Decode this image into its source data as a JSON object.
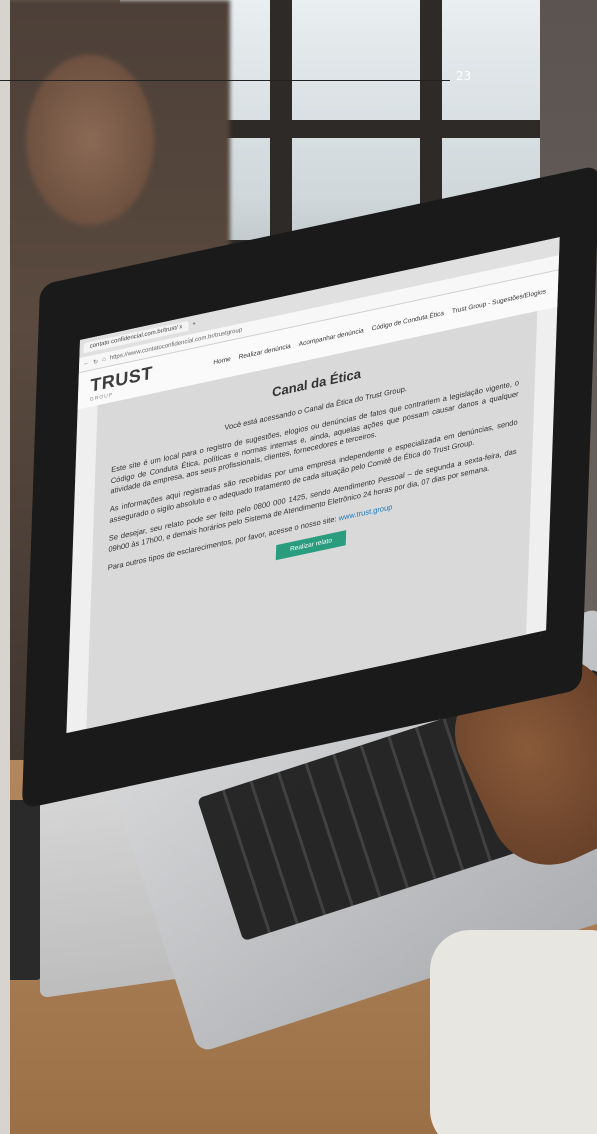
{
  "page_number": "23",
  "browser": {
    "tab_title": "contato confidencial.com.br/trust/ x",
    "url": "https://www.contatoconfidencial.com.br/trustgroup"
  },
  "site": {
    "logo_text": "TRUST",
    "logo_sub": "GROUP",
    "nav": [
      "Home",
      "Realizar denúncia",
      "Acompanhar denúncia",
      "Código de Conduta Ética",
      "Trust Group - Sugestões/Elogios"
    ],
    "title": "Canal da Ética",
    "intro": "Você está acessando o Canal da Ética do Trust Group.",
    "paragraph1": "Este site é um local para o registro de sugestões, elogios ou denúncias de fatos que contrariem a legislação vigente, o Código de Conduta Ética, políticas e normas internas e, ainda, aquelas ações que possam causar danos a qualquer atividade da empresa, aos seus profissionais, clientes, fornecedores e terceiros.",
    "paragraph2": "As informações aqui registradas são recebidas por uma empresa independente e especializada em denúncias, sendo assegurado o sigilo absoluto e o adequado tratamento de cada situação pelo Comitê de Ética do Trust Group.",
    "paragraph3": "Se desejar, seu relato pode ser feito pelo 0800 000 1425, sendo Atendimento Pessoal – de segunda a sexta-feira, das 09h00 às 17h00, e demais horários pelo Sistema de Atendimento Eletrônico 24 horas por dia, 07 dias por semana.",
    "paragraph4": "Para outros tipos de esclarecimentos, por favor, acesse o nosso site:",
    "site_link": "www.trust.group",
    "cta_label": "Realizar relato"
  },
  "colors": {
    "cta": "#2a9d7e",
    "link": "#1a7abf"
  }
}
